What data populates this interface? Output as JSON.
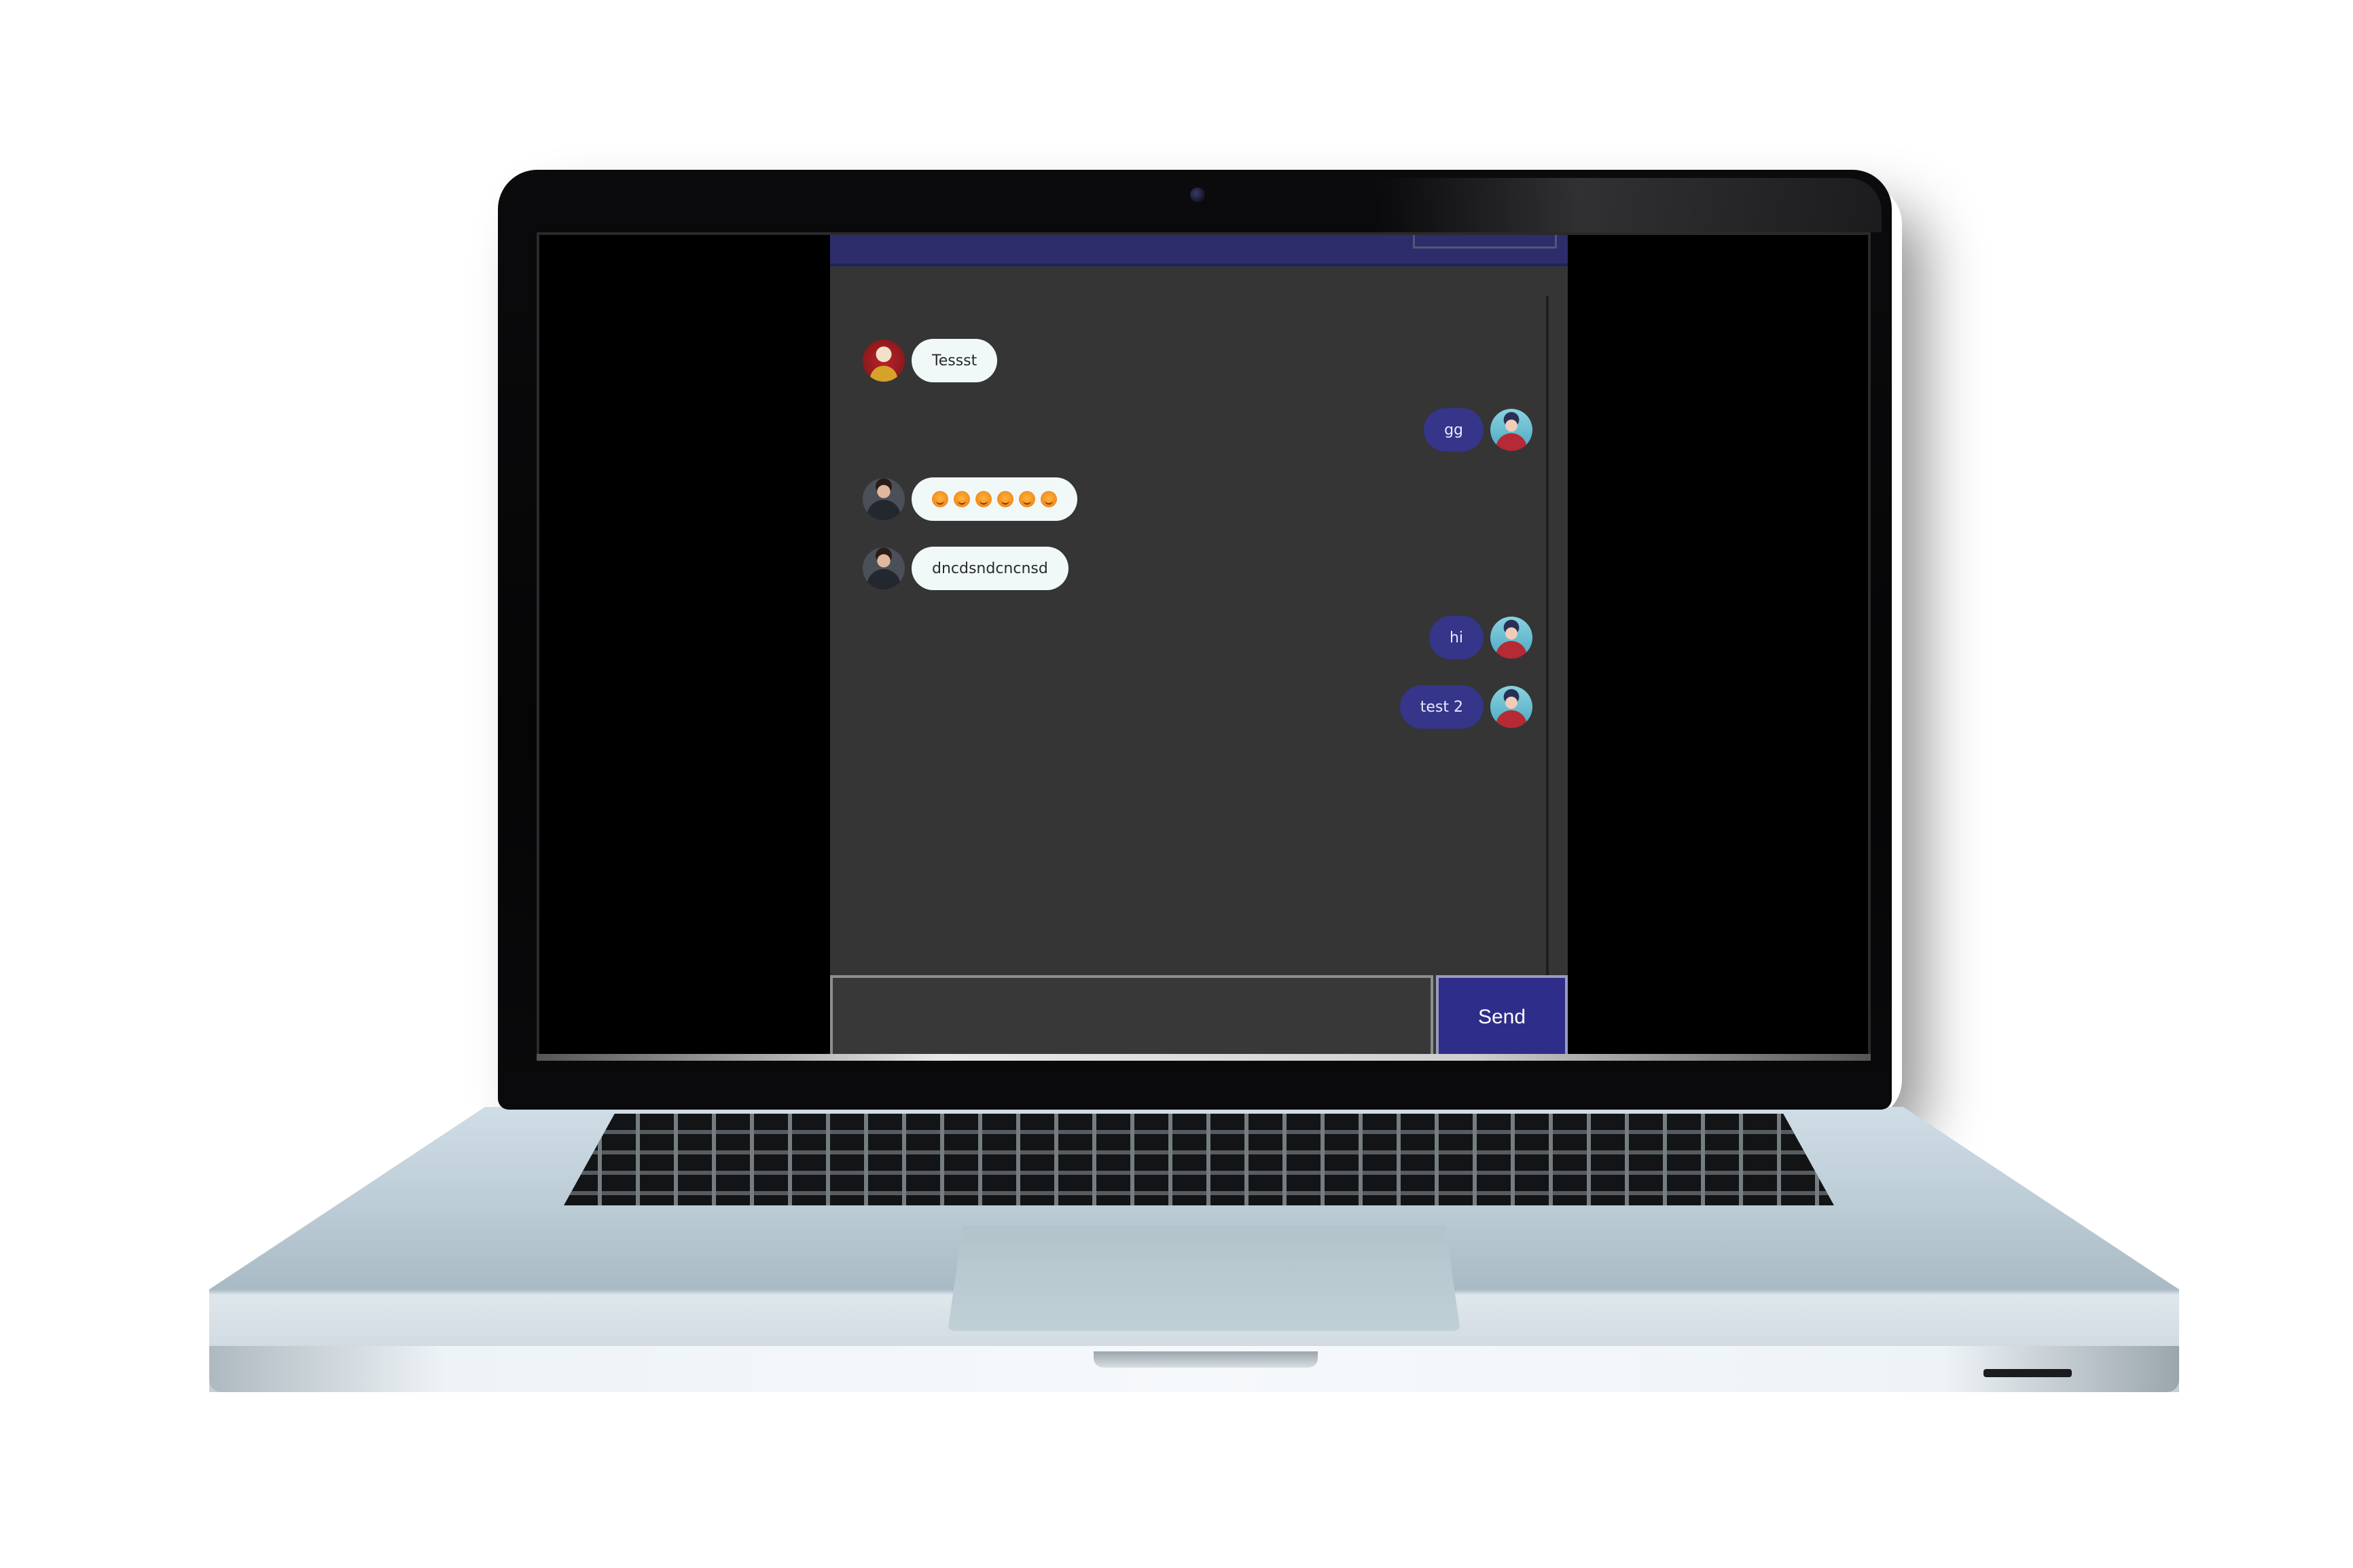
{
  "window": {
    "title": ""
  },
  "colors": {
    "header": "#2d2d6b",
    "chat_background": "#353535",
    "incoming_bubble": "#f1f8f8",
    "outgoing_bubble": "#35358a",
    "send_button": "#2e2e8a"
  },
  "messages": [
    {
      "side": "left",
      "avatar": "red-hero-avatar",
      "text": "Tessst"
    },
    {
      "side": "right",
      "avatar": "teal-user-avatar",
      "text": "gg"
    },
    {
      "side": "left",
      "avatar": "dark-user-avatar",
      "text": "",
      "emoji_count": 6,
      "emoji": "orange-face-emoji-icon"
    },
    {
      "side": "left",
      "avatar": "dark-user-avatar",
      "text": "dncdsndcncnsd"
    },
    {
      "side": "right",
      "avatar": "teal-user-avatar",
      "text": "hi"
    },
    {
      "side": "right",
      "avatar": "teal-user-avatar",
      "text": "test 2"
    }
  ],
  "composer": {
    "input_value": "",
    "input_placeholder": "",
    "send_label": "Send"
  }
}
